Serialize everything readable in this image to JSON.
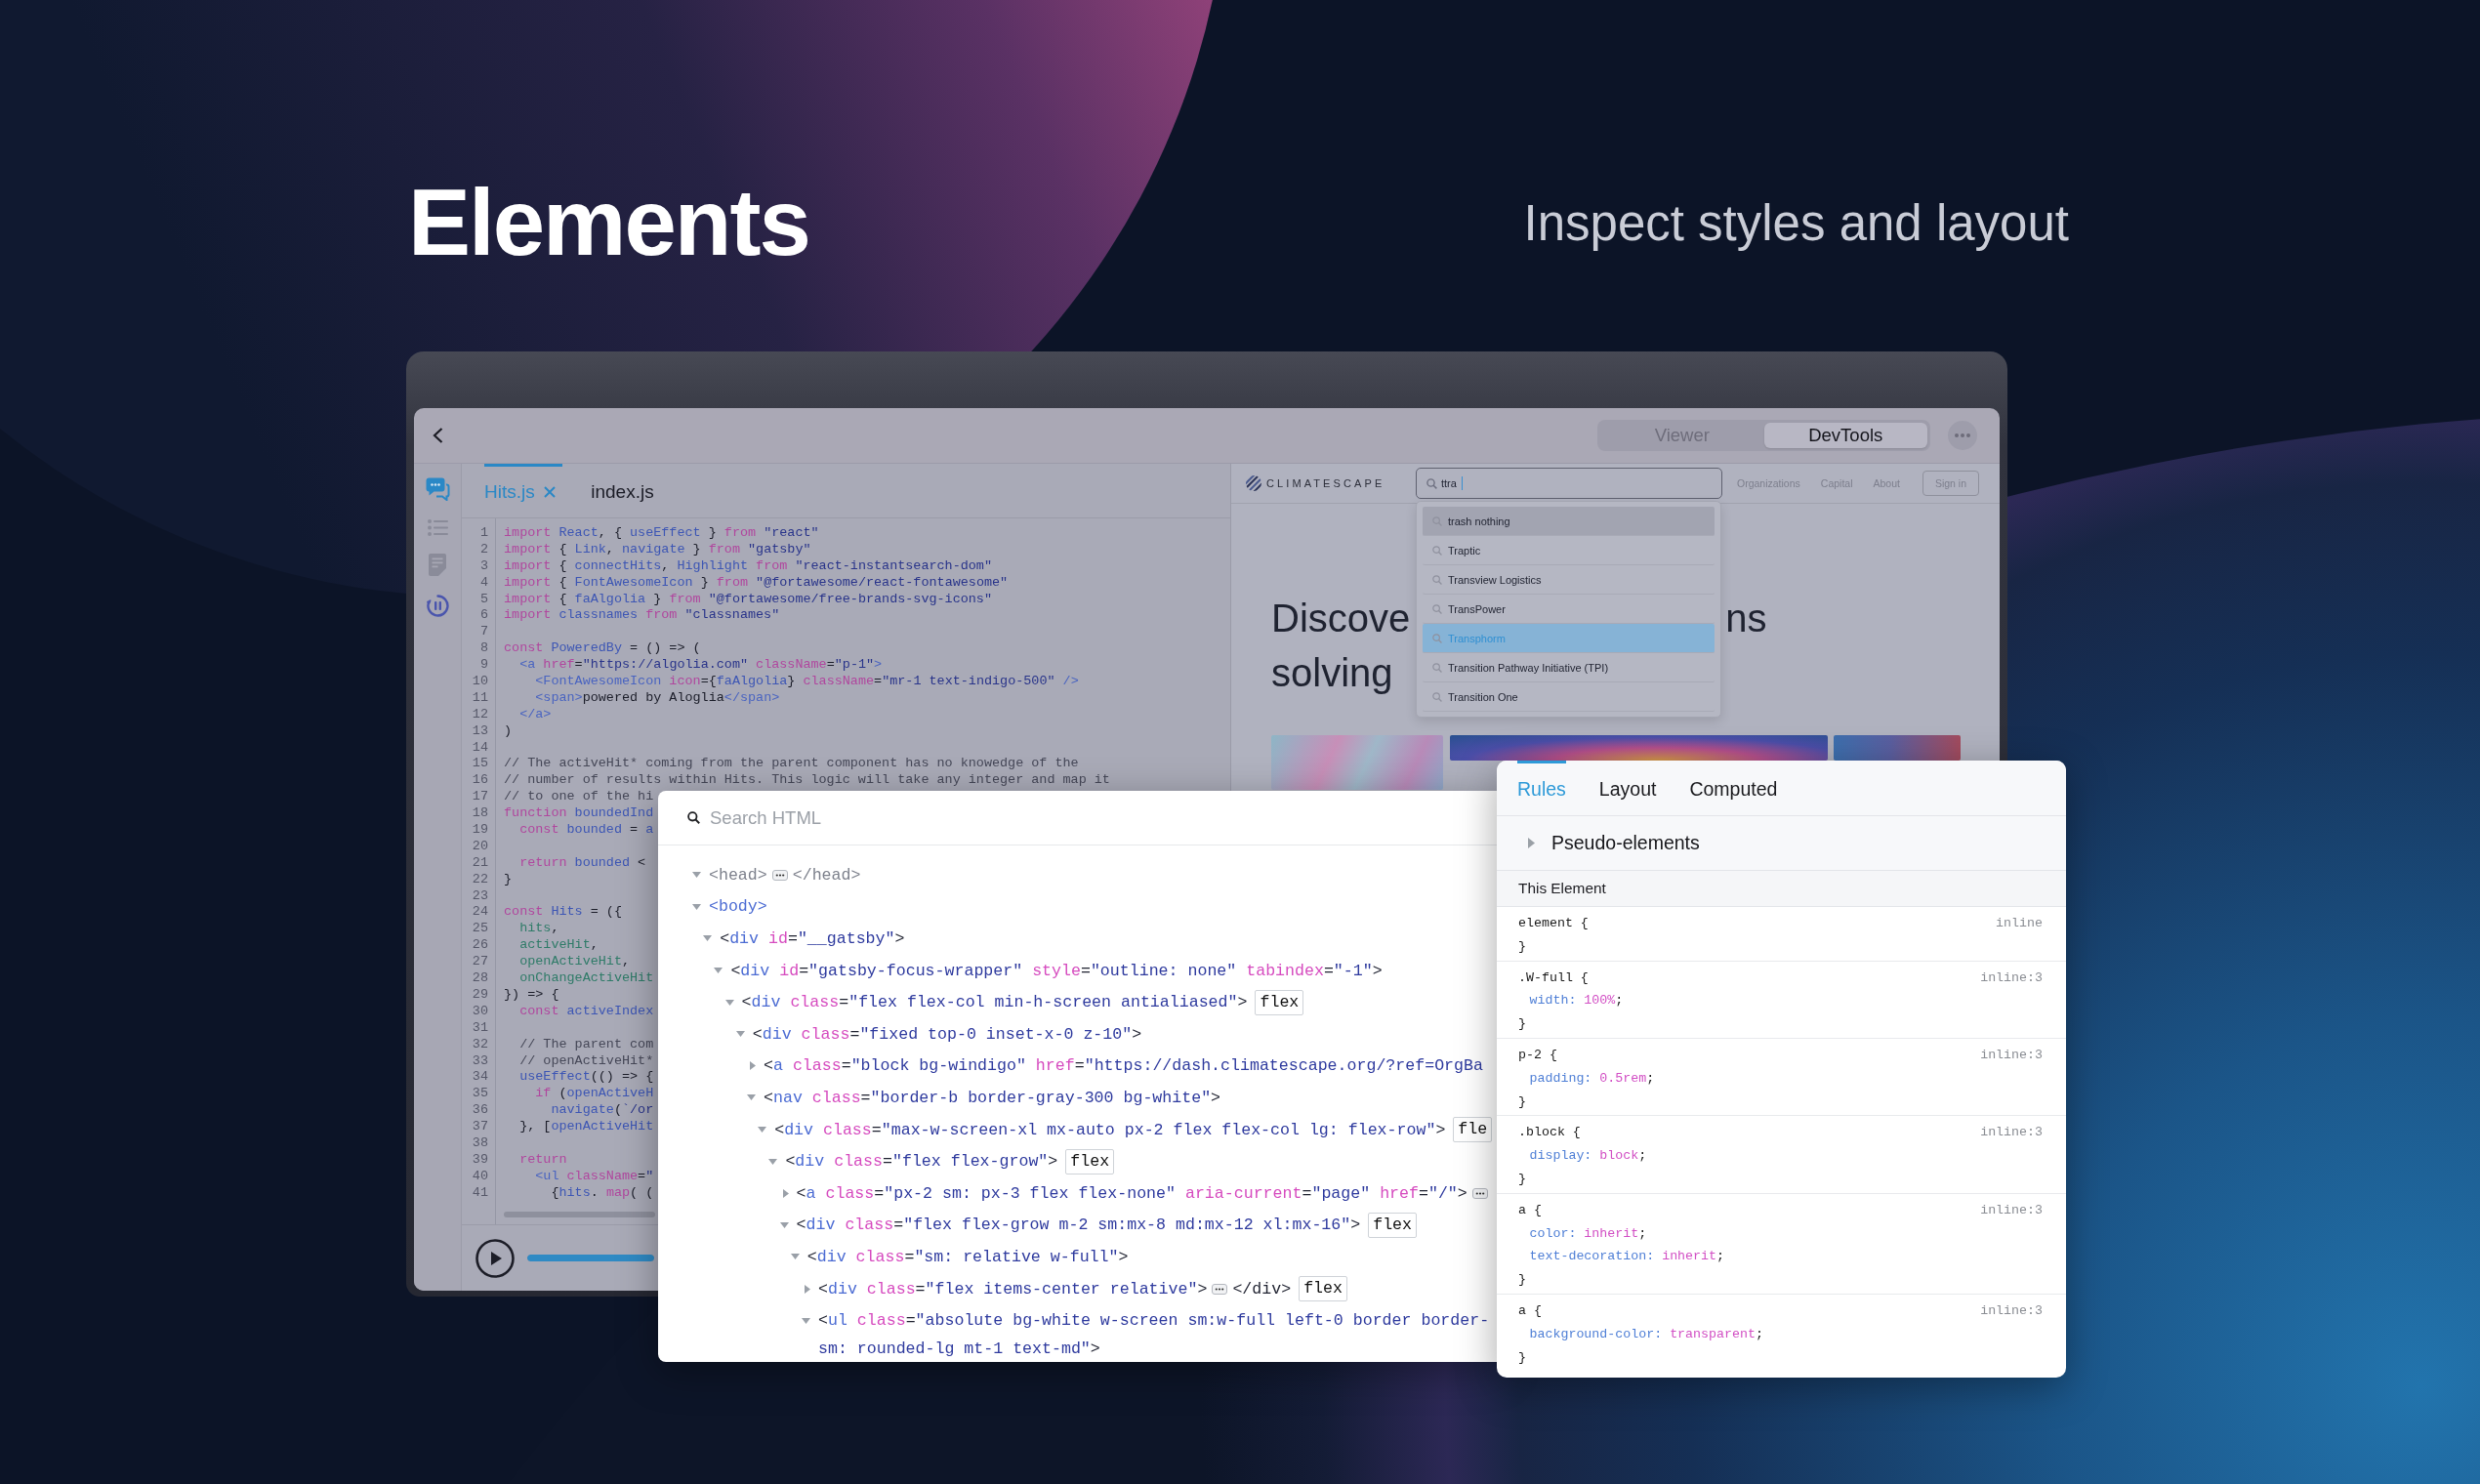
{
  "header": {
    "title": "Elements",
    "subtitle": "Inspect styles and layout"
  },
  "app_window": {
    "view_modes": [
      {
        "label": "Viewer",
        "selected": false
      },
      {
        "label": "DevTools",
        "selected": true
      }
    ],
    "sidebar": [
      {
        "kind": "chat",
        "selected": true
      },
      {
        "kind": "list",
        "selected": false
      },
      {
        "kind": "notes",
        "selected": false
      },
      {
        "kind": "timer",
        "selected": false
      }
    ],
    "editor": {
      "tabs": [
        {
          "label": "Hits.js",
          "selected": true,
          "closable": true
        },
        {
          "label": "index.js",
          "selected": false,
          "closable": false
        }
      ],
      "lines": [
        {
          "number": "1",
          "tokens": [
            {
              "kind": "kw",
              "text": "import "
            },
            {
              "kind": "name",
              "text": "React"
            },
            {
              "kind": "text",
              "text": ", { "
            },
            {
              "kind": "name",
              "text": "useEffect"
            },
            {
              "kind": "text",
              "text": " } "
            },
            {
              "kind": "kw",
              "text": "from "
            },
            {
              "kind": "str",
              "text": "\"react\""
            }
          ]
        },
        {
          "number": "2",
          "tokens": [
            {
              "kind": "kw",
              "text": "import "
            },
            {
              "kind": "text",
              "text": "{ "
            },
            {
              "kind": "name",
              "text": "Link"
            },
            {
              "kind": "text",
              "text": ", "
            },
            {
              "kind": "name",
              "text": "navigate"
            },
            {
              "kind": "text",
              "text": " } "
            },
            {
              "kind": "kw",
              "text": "from "
            },
            {
              "kind": "str",
              "text": "\"gatsby\""
            }
          ]
        },
        {
          "number": "3",
          "tokens": [
            {
              "kind": "kw",
              "text": "import "
            },
            {
              "kind": "text",
              "text": "{ "
            },
            {
              "kind": "name",
              "text": "connectHits"
            },
            {
              "kind": "text",
              "text": ", "
            },
            {
              "kind": "name",
              "text": "Highlight "
            },
            {
              "kind": "kw",
              "text": "from "
            },
            {
              "kind": "str",
              "text": "\"react-instantsearch-dom\""
            }
          ]
        },
        {
          "number": "4",
          "tokens": [
            {
              "kind": "kw",
              "text": "import "
            },
            {
              "kind": "text",
              "text": "{ "
            },
            {
              "kind": "name",
              "text": "FontAwesomeIcon"
            },
            {
              "kind": "text",
              "text": " } "
            },
            {
              "kind": "kw",
              "text": "from "
            },
            {
              "kind": "str",
              "text": "\"@fortawesome/react-fontawesome\""
            }
          ]
        },
        {
          "number": "5",
          "tokens": [
            {
              "kind": "kw",
              "text": "import "
            },
            {
              "kind": "text",
              "text": "{ "
            },
            {
              "kind": "name",
              "text": "faAlgolia"
            },
            {
              "kind": "text",
              "text": " } "
            },
            {
              "kind": "kw",
              "text": "from "
            },
            {
              "kind": "str",
              "text": "\"@fortawesome/free-brands-svg-icons\""
            }
          ]
        },
        {
          "number": "6",
          "tokens": [
            {
              "kind": "kw",
              "text": "import "
            },
            {
              "kind": "name",
              "text": "classnames "
            },
            {
              "kind": "kw",
              "text": "from "
            },
            {
              "kind": "str",
              "text": "\"classnames\""
            }
          ]
        },
        {
          "number": "7"
        },
        {
          "number": "8",
          "tokens": [
            {
              "kind": "kw",
              "text": "const "
            },
            {
              "kind": "name",
              "text": "PoweredBy"
            },
            {
              "kind": "text",
              "text": " = () => ("
            }
          ]
        },
        {
          "number": "9",
          "tokens": [
            {
              "kind": "tag",
              "text": "  <a "
            },
            {
              "kind": "attr",
              "text": "href"
            },
            {
              "kind": "text",
              "text": "="
            },
            {
              "kind": "str",
              "text": "\"https://algolia.com\" "
            },
            {
              "kind": "attr",
              "text": "className"
            },
            {
              "kind": "text",
              "text": "="
            },
            {
              "kind": "str",
              "text": "\"p-1\""
            },
            {
              "kind": "tag",
              "text": ">"
            }
          ]
        },
        {
          "number": "10",
          "tokens": [
            {
              "kind": "tag",
              "text": "    <FontAwesomeIcon "
            },
            {
              "kind": "attr",
              "text": "icon"
            },
            {
              "kind": "text",
              "text": "={"
            },
            {
              "kind": "name",
              "text": "faAlgolia"
            },
            {
              "kind": "text",
              "text": "} "
            },
            {
              "kind": "attr",
              "text": "className"
            },
            {
              "kind": "text",
              "text": "="
            },
            {
              "kind": "str",
              "text": "\"mr-1 text-indigo-500\" "
            },
            {
              "kind": "tag",
              "text": "/>"
            }
          ]
        },
        {
          "number": "11",
          "tokens": [
            {
              "kind": "tag",
              "text": "    <span>"
            },
            {
              "kind": "text",
              "text": "powered by Aloglia"
            },
            {
              "kind": "tag",
              "text": "</span>"
            }
          ]
        },
        {
          "number": "12",
          "tokens": [
            {
              "kind": "tag",
              "text": "  </a>"
            }
          ]
        },
        {
          "number": "13",
          "tokens": [
            {
              "kind": "text",
              "text": ")"
            }
          ]
        },
        {
          "number": "14"
        },
        {
          "number": "15",
          "tokens": [
            {
              "kind": "cmt",
              "text": "// The activeHit* coming from the parent component has no knowedge of the"
            }
          ]
        },
        {
          "number": "16",
          "tokens": [
            {
              "kind": "cmt",
              "text": "// number of results within Hits. This logic will take any integer and map it"
            }
          ]
        },
        {
          "number": "17",
          "tokens": [
            {
              "kind": "cmt",
              "text": "// to one of the hi"
            }
          ]
        },
        {
          "number": "18",
          "tokens": [
            {
              "kind": "kw",
              "text": "function "
            },
            {
              "kind": "name",
              "text": "boundedInd"
            }
          ]
        },
        {
          "number": "19",
          "tokens": [
            {
              "kind": "kw",
              "text": "  const "
            },
            {
              "kind": "name",
              "text": "bounded"
            },
            {
              "kind": "text",
              "text": " = "
            },
            {
              "kind": "name",
              "text": "a"
            }
          ]
        },
        {
          "number": "20"
        },
        {
          "number": "21",
          "tokens": [
            {
              "kind": "kw",
              "text": "  return "
            },
            {
              "kind": "name",
              "text": "bounded"
            },
            {
              "kind": "text",
              "text": " <"
            }
          ]
        },
        {
          "number": "22",
          "tokens": [
            {
              "kind": "text",
              "text": "}"
            }
          ]
        },
        {
          "number": "23"
        },
        {
          "number": "24",
          "tokens": [
            {
              "kind": "kw",
              "text": "const "
            },
            {
              "kind": "name",
              "text": "Hits"
            },
            {
              "kind": "text",
              "text": " = ({"
            }
          ]
        },
        {
          "number": "25",
          "tokens": [
            {
              "kind": "param",
              "text": "  hits"
            },
            {
              "kind": "text",
              "text": ","
            }
          ]
        },
        {
          "number": "26",
          "tokens": [
            {
              "kind": "param",
              "text": "  activeHit"
            },
            {
              "kind": "text",
              "text": ","
            }
          ]
        },
        {
          "number": "27",
          "tokens": [
            {
              "kind": "param",
              "text": "  openActiveHit"
            },
            {
              "kind": "text",
              "text": ","
            }
          ]
        },
        {
          "number": "28",
          "tokens": [
            {
              "kind": "param",
              "text": "  onChangeActiveHit"
            }
          ]
        },
        {
          "number": "29",
          "tokens": [
            {
              "kind": "text",
              "text": "}) => {"
            }
          ]
        },
        {
          "number": "30",
          "tokens": [
            {
              "kind": "kw",
              "text": "  const "
            },
            {
              "kind": "name",
              "text": "activeIndex"
            }
          ]
        },
        {
          "number": "31"
        },
        {
          "number": "32",
          "tokens": [
            {
              "kind": "cmt",
              "text": "  // The parent com"
            }
          ]
        },
        {
          "number": "33",
          "tokens": [
            {
              "kind": "cmt",
              "text": "  // openActiveHit*"
            }
          ]
        },
        {
          "number": "34",
          "tokens": [
            {
              "kind": "name",
              "text": "  useEffect"
            },
            {
              "kind": "text",
              "text": "(() => {"
            }
          ]
        },
        {
          "number": "35",
          "tokens": [
            {
              "kind": "kw",
              "text": "    if "
            },
            {
              "kind": "text",
              "text": "("
            },
            {
              "kind": "name",
              "text": "openActiveH"
            }
          ]
        },
        {
          "number": "36",
          "tokens": [
            {
              "kind": "name",
              "text": "      navigate"
            },
            {
              "kind": "text",
              "text": "("
            },
            {
              "kind": "str",
              "text": "`/or"
            }
          ]
        },
        {
          "number": "37",
          "tokens": [
            {
              "kind": "text",
              "text": "  }, ["
            },
            {
              "kind": "name",
              "text": "openActiveHit"
            }
          ]
        },
        {
          "number": "38"
        },
        {
          "number": "39",
          "tokens": [
            {
              "kind": "kw",
              "text": "  return"
            }
          ]
        },
        {
          "number": "40",
          "tokens": [
            {
              "kind": "tag",
              "text": "    <ul "
            },
            {
              "kind": "attr",
              "text": "className"
            },
            {
              "kind": "text",
              "text": "="
            },
            {
              "kind": "str",
              "text": "\""
            }
          ]
        },
        {
          "number": "41",
          "tokens": [
            {
              "kind": "text",
              "text": "      {"
            },
            {
              "kind": "name",
              "text": "hits"
            },
            {
              "kind": "text",
              "text": ". "
            },
            {
              "kind": "kw",
              "text": "map"
            },
            {
              "kind": "text",
              "text": "( ("
            }
          ]
        }
      ],
      "playback": {
        "level": 1
      }
    },
    "preview": {
      "logo": "CLIMATESCAPE",
      "search": {
        "value": "ttra"
      },
      "nav_links": [
        "Organizations",
        "Capital",
        "About"
      ],
      "sign_in": "Sign in",
      "suggestions": [
        {
          "label": "trash nothing",
          "selected": false,
          "highlighted": true
        },
        {
          "label": "Traptic",
          "selected": false,
          "highlighted": false
        },
        {
          "label": "Transview Logistics",
          "selected": false,
          "highlighted": false
        },
        {
          "label": "TransPower",
          "selected": false,
          "highlighted": false
        },
        {
          "label": "Transphorm",
          "selected": true,
          "highlighted": false
        },
        {
          "label": "Transition Pathway Initiative (TPI)",
          "selected": false,
          "highlighted": false
        },
        {
          "label": "Transition One",
          "selected": false,
          "highlighted": false
        }
      ],
      "hero": {
        "line_1_left": "Discove",
        "line_1_right": "ns",
        "line_2": "solving"
      }
    }
  },
  "html_panel": {
    "search": {
      "placeholder": "Search HTML"
    },
    "tree": [
      {
        "tokens": [
          {
            "kind": "dim",
            "text": "<head>"
          }
        ],
        "expanded": true,
        "ellipsis": true,
        "close": [
          {
            "kind": "dim",
            "text": "</head>"
          }
        ]
      },
      {
        "tokens": [
          {
            "kind": "tag",
            "text": "<body>"
          }
        ],
        "expanded": true,
        "children": [
          {
            "tokens": [
              {
                "kind": "p",
                "text": "<"
              },
              {
                "kind": "tag",
                "text": "div "
              },
              {
                "kind": "attr",
                "text": "id"
              },
              {
                "kind": "p",
                "text": "="
              },
              {
                "kind": "val",
                "text": "\"__gatsby\""
              },
              {
                "kind": "p",
                "text": ">"
              }
            ],
            "expanded": true,
            "children": [
              {
                "tokens": [
                  {
                    "kind": "p",
                    "text": "<"
                  },
                  {
                    "kind": "tag",
                    "text": "div "
                  },
                  {
                    "kind": "attr",
                    "text": "id"
                  },
                  {
                    "kind": "p",
                    "text": "="
                  },
                  {
                    "kind": "val",
                    "text": "\"gatsby-focus-wrapper\" "
                  },
                  {
                    "kind": "attr",
                    "text": "style"
                  },
                  {
                    "kind": "p",
                    "text": "="
                  },
                  {
                    "kind": "val",
                    "text": "\"outline: none\" "
                  },
                  {
                    "kind": "attr",
                    "text": "tabindex"
                  },
                  {
                    "kind": "p",
                    "text": "="
                  },
                  {
                    "kind": "val",
                    "text": "\"-1\""
                  },
                  {
                    "kind": "p",
                    "text": ">"
                  }
                ],
                "expanded": true,
                "children": [
                  {
                    "tokens": [
                      {
                        "kind": "p",
                        "text": "<"
                      },
                      {
                        "kind": "tag",
                        "text": "div "
                      },
                      {
                        "kind": "attr",
                        "text": "class"
                      },
                      {
                        "kind": "p",
                        "text": "="
                      },
                      {
                        "kind": "val",
                        "text": "\"flex flex-col min-h-screen antialiased\""
                      },
                      {
                        "kind": "p",
                        "text": ">"
                      }
                    ],
                    "expanded": true,
                    "badge": "flex",
                    "children": [
                      {
                        "tokens": [
                          {
                            "kind": "p",
                            "text": "<"
                          },
                          {
                            "kind": "tag",
                            "text": "div "
                          },
                          {
                            "kind": "attr",
                            "text": "class"
                          },
                          {
                            "kind": "p",
                            "text": "="
                          },
                          {
                            "kind": "val",
                            "text": "\"fixed top-0 inset-x-0 z-10\""
                          },
                          {
                            "kind": "p",
                            "text": ">"
                          }
                        ],
                        "expanded": true,
                        "children": [
                          {
                            "tokens": [
                              {
                                "kind": "p",
                                "text": "<"
                              },
                              {
                                "kind": "tag",
                                "text": "a "
                              },
                              {
                                "kind": "attr",
                                "text": "class"
                              },
                              {
                                "kind": "p",
                                "text": "="
                              },
                              {
                                "kind": "val",
                                "text": "\"block bg-windigo\" "
                              },
                              {
                                "kind": "attr",
                                "text": "href"
                              },
                              {
                                "kind": "p",
                                "text": "="
                              },
                              {
                                "kind": "val",
                                "text": "\"https://dash.climatescape.org/?ref=OrgBa"
                              }
                            ],
                            "expanded": false
                          },
                          {
                            "tokens": [
                              {
                                "kind": "p",
                                "text": "<"
                              },
                              {
                                "kind": "tag",
                                "text": "nav "
                              },
                              {
                                "kind": "attr",
                                "text": "class"
                              },
                              {
                                "kind": "p",
                                "text": "="
                              },
                              {
                                "kind": "val",
                                "text": "\"border-b border-gray-300 bg-white\""
                              },
                              {
                                "kind": "p",
                                "text": ">"
                              }
                            ],
                            "expanded": true,
                            "children": [
                              {
                                "tokens": [
                                  {
                                    "kind": "p",
                                    "text": "<"
                                  },
                                  {
                                    "kind": "tag",
                                    "text": "div "
                                  },
                                  {
                                    "kind": "attr",
                                    "text": "class"
                                  },
                                  {
                                    "kind": "p",
                                    "text": "="
                                  },
                                  {
                                    "kind": "val",
                                    "text": "\"max-w-screen-xl mx-auto px-2 flex flex-col lg: flex-row\""
                                  },
                                  {
                                    "kind": "p",
                                    "text": ">"
                                  }
                                ],
                                "expanded": true,
                                "badge": "fle",
                                "children": [
                                  {
                                    "tokens": [
                                      {
                                        "kind": "p",
                                        "text": "<"
                                      },
                                      {
                                        "kind": "tag",
                                        "text": "div "
                                      },
                                      {
                                        "kind": "attr",
                                        "text": "class"
                                      },
                                      {
                                        "kind": "p",
                                        "text": "="
                                      },
                                      {
                                        "kind": "val",
                                        "text": "\"flex flex-grow\""
                                      },
                                      {
                                        "kind": "p",
                                        "text": ">"
                                      }
                                    ],
                                    "expanded": true,
                                    "badge": "flex",
                                    "children": [
                                      {
                                        "tokens": [
                                          {
                                            "kind": "p",
                                            "text": "<"
                                          },
                                          {
                                            "kind": "tag",
                                            "text": "a "
                                          },
                                          {
                                            "kind": "attr",
                                            "text": "class"
                                          },
                                          {
                                            "kind": "p",
                                            "text": "="
                                          },
                                          {
                                            "kind": "val",
                                            "text": "\"px-2 sm: px-3 flex flex-none\" "
                                          },
                                          {
                                            "kind": "attr",
                                            "text": "aria-current"
                                          },
                                          {
                                            "kind": "p",
                                            "text": "="
                                          },
                                          {
                                            "kind": "val",
                                            "text": "\"page\" "
                                          },
                                          {
                                            "kind": "attr",
                                            "text": "href"
                                          },
                                          {
                                            "kind": "p",
                                            "text": "="
                                          },
                                          {
                                            "kind": "val",
                                            "text": "\"/\""
                                          },
                                          {
                                            "kind": "p",
                                            "text": ">"
                                          }
                                        ],
                                        "expanded": false,
                                        "ellipsis": true
                                      },
                                      {
                                        "tokens": [
                                          {
                                            "kind": "p",
                                            "text": "<"
                                          },
                                          {
                                            "kind": "tag",
                                            "text": "div "
                                          },
                                          {
                                            "kind": "attr",
                                            "text": "class"
                                          },
                                          {
                                            "kind": "p",
                                            "text": "="
                                          },
                                          {
                                            "kind": "val",
                                            "text": "\"flex flex-grow m-2 sm:mx-8 md:mx-12 xl:mx-16\""
                                          },
                                          {
                                            "kind": "p",
                                            "text": ">"
                                          }
                                        ],
                                        "expanded": true,
                                        "badge": "flex",
                                        "children": [
                                          {
                                            "tokens": [
                                              {
                                                "kind": "p",
                                                "text": "<"
                                              },
                                              {
                                                "kind": "tag",
                                                "text": "div "
                                              },
                                              {
                                                "kind": "attr",
                                                "text": "class"
                                              },
                                              {
                                                "kind": "p",
                                                "text": "="
                                              },
                                              {
                                                "kind": "val",
                                                "text": "\"sm: relative w-full\""
                                              },
                                              {
                                                "kind": "p",
                                                "text": ">"
                                              }
                                            ],
                                            "expanded": true,
                                            "children": [
                                              {
                                                "tokens": [
                                                  {
                                                    "kind": "p",
                                                    "text": "<"
                                                  },
                                                  {
                                                    "kind": "tag",
                                                    "text": "div "
                                                  },
                                                  {
                                                    "kind": "attr",
                                                    "text": "class"
                                                  },
                                                  {
                                                    "kind": "p",
                                                    "text": "="
                                                  },
                                                  {
                                                    "kind": "val",
                                                    "text": "\"flex items-center relative\""
                                                  },
                                                  {
                                                    "kind": "p",
                                                    "text": ">"
                                                  }
                                                ],
                                                "expanded": false,
                                                "ellipsis": true,
                                                "close": [
                                                  {
                                                    "kind": "p",
                                                    "text": "</div>"
                                                  }
                                                ],
                                                "badge": "flex"
                                              },
                                              {
                                                "tokens": [
                                                  {
                                                    "kind": "p",
                                                    "text": "<"
                                                  },
                                                  {
                                                    "kind": "tag",
                                                    "text": "ul "
                                                  },
                                                  {
                                                    "kind": "attr",
                                                    "text": "class"
                                                  },
                                                  {
                                                    "kind": "p",
                                                    "text": "="
                                                  },
                                                  {
                                                    "kind": "val",
                                                    "text": "\"absolute bg-white w-screen sm:w-full left-0 border border-"
                                                  }
                                                ],
                                                "continuation": [
                                                  {
                                                    "kind": "val",
                                                    "text": "sm: rounded-lg mt-1 text-md\""
                                                  },
                                                  {
                                                    "kind": "p",
                                                    "text": ">"
                                                  }
                                                ],
                                                "expanded": true
                                              }
                                            ]
                                          }
                                        ]
                                      }
                                    ]
                                  }
                                ]
                              }
                            ]
                          }
                        ]
                      }
                    ]
                  }
                ]
              }
            ]
          }
        ]
      }
    ]
  },
  "styles_panel": {
    "tabs": [
      {
        "label": "Rules",
        "selected": true
      },
      {
        "label": "Layout",
        "selected": false
      },
      {
        "label": "Computed",
        "selected": false
      }
    ],
    "pseudo_elements": {
      "label": "Pseudo-elements",
      "expanded": false
    },
    "section": "This Element",
    "rules": [
      {
        "selector": "element {",
        "source": "inline",
        "close": "}"
      },
      {
        "selector": ".W-full {",
        "source": "inline:3",
        "declarations": [
          [
            {
              "kind": "prop",
              "text": "width: "
            },
            {
              "kind": "val",
              "text": "100%"
            },
            {
              "kind": "text",
              "text": ";"
            }
          ]
        ],
        "close": "}"
      },
      {
        "selector": "p-2 {",
        "source": "inline:3",
        "declarations": [
          [
            {
              "kind": "prop",
              "text": "padding: "
            },
            {
              "kind": "val",
              "text": "0.5rem"
            },
            {
              "kind": "text",
              "text": ";"
            }
          ]
        ],
        "close": "}"
      },
      {
        "selector": ".block {",
        "source": "inline:3",
        "declarations": [
          [
            {
              "kind": "prop",
              "text": "display: "
            },
            {
              "kind": "val",
              "text": "block"
            },
            {
              "kind": "text",
              "text": ";"
            }
          ]
        ],
        "close": "}"
      },
      {
        "selector": "a {",
        "source": "inline:3",
        "declarations": [
          [
            {
              "kind": "prop",
              "text": "color: "
            },
            {
              "kind": "val",
              "text": "inherit"
            },
            {
              "kind": "text",
              "text": ";"
            }
          ],
          [
            {
              "kind": "prop",
              "text": "text-decoration: "
            },
            {
              "kind": "val",
              "text": "inherit"
            },
            {
              "kind": "text",
              "text": ";"
            }
          ]
        ],
        "close": "}"
      },
      {
        "selector": "a {",
        "source": "inline:3",
        "declarations": [
          [
            {
              "kind": "prop",
              "text": "background-color: "
            },
            {
              "kind": "val",
              "text": "transparent"
            },
            {
              "kind": "text",
              "text": ";"
            }
          ]
        ],
        "close": "}"
      }
    ]
  }
}
